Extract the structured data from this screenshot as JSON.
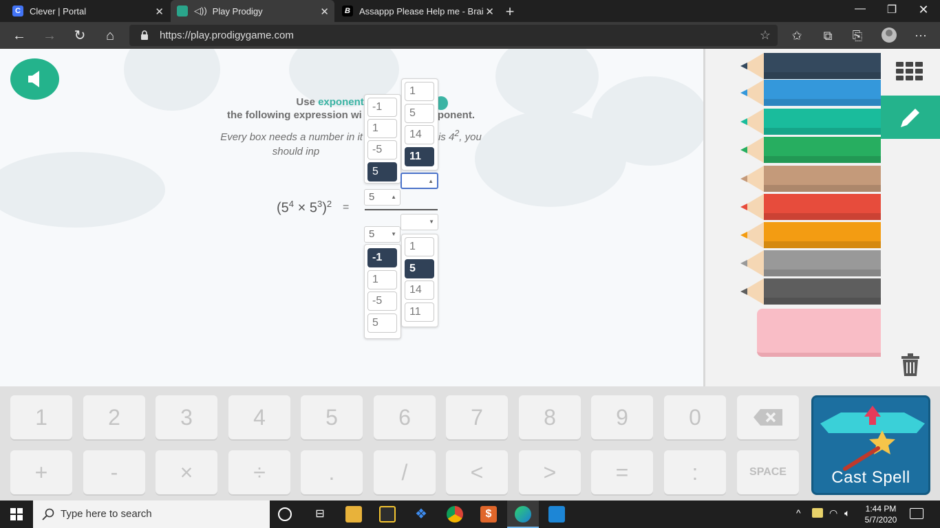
{
  "browser": {
    "tabs": [
      {
        "title": "Clever | Portal",
        "icon": "clever-icon",
        "fav_color": "#4274f6",
        "fav_text": "C"
      },
      {
        "title": "Play Prodigy",
        "icon": "prodigy-icon",
        "fav_color": "#2aa58b",
        "fav_text": ""
      },
      {
        "title": "Assappp Please Help me - Brainl",
        "icon": "brainly-icon",
        "fav_color": "#000000",
        "fav_text": "B"
      }
    ],
    "url": "https://play.prodigygame.com"
  },
  "question": {
    "line1_a": "Use ",
    "line1_accent": "exponent properti",
    "line2_a": "the following expression wi",
    "line2_b": "ponent.",
    "line3_a": "Every box needs a number in it",
    "line3_b": "is 4",
    "line3_sup": "2",
    "line3_c": ", you",
    "line4": "should inp",
    "expr_base1": "5",
    "expr_exp1": "4",
    "expr_times": " × ",
    "expr_base2": "5",
    "expr_exp2": "3",
    "expr_outer_exp": "2",
    "equals": "="
  },
  "dropdowns": {
    "top_left_options": [
      "-1",
      "1",
      "-5",
      "5"
    ],
    "top_left_selected": "5",
    "top_right_options": [
      "1",
      "5",
      "14",
      "11"
    ],
    "top_right_selected": "11",
    "numerator_base": "5",
    "numerator_exp": "",
    "denominator_base": "5",
    "denominator_exp": "",
    "bottom_left_options": [
      "-1",
      "1",
      "-5",
      "5"
    ],
    "bottom_left_selected": "-1",
    "bottom_right_options": [
      "1",
      "5",
      "14",
      "11"
    ],
    "bottom_right_selected": "5"
  },
  "pencils": [
    {
      "color": "#34495e",
      "name": "navy"
    },
    {
      "color": "#3498db",
      "name": "blue"
    },
    {
      "color": "#1abc9c",
      "name": "teal"
    },
    {
      "color": "#27ae60",
      "name": "green"
    },
    {
      "color": "#c49a7a",
      "name": "tan"
    },
    {
      "color": "#e74c3c",
      "name": "red"
    },
    {
      "color": "#f39c12",
      "name": "orange"
    },
    {
      "color": "#999999",
      "name": "gray"
    },
    {
      "color": "#5e5e5e",
      "name": "dark-gray"
    }
  ],
  "keypad": {
    "row1": [
      "1",
      "2",
      "3",
      "4",
      "5",
      "6",
      "7",
      "8",
      "9",
      "0"
    ],
    "row2": [
      "+",
      "-",
      "×",
      "÷",
      ".",
      "/",
      "<",
      ">",
      "=",
      ":"
    ],
    "space": "SPACE",
    "cast_spell": "Cast Spell"
  },
  "taskbar": {
    "search_placeholder": "Type here to search",
    "time": "1:44 PM",
    "date": "5/7/2020"
  }
}
